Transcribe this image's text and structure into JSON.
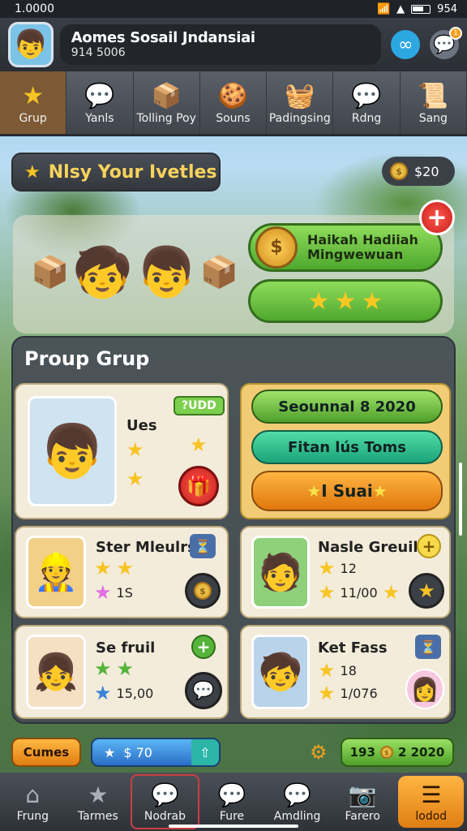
{
  "status_bar": {
    "time": "1.0000",
    "battery": "954"
  },
  "header": {
    "name": "Aomes Sosail Jndansiai",
    "id": "914 5006"
  },
  "tabs": [
    {
      "label": "Grup",
      "icon": "★"
    },
    {
      "label": "Yanls",
      "icon": "💬"
    },
    {
      "label": "Tolling Poy",
      "icon": "📦"
    },
    {
      "label": "Souns",
      "icon": "🍪"
    },
    {
      "label": "Padingsing",
      "icon": "🧺"
    },
    {
      "label": "Rdng",
      "icon": "💬"
    },
    {
      "label": "Sang",
      "icon": "📜"
    }
  ],
  "title_pill": {
    "text": "Nlsy Your Ivetles"
  },
  "coins": {
    "amount": "$20"
  },
  "banner": {
    "reward_label": "Haikah Hadiiah Mingwewuan"
  },
  "group": {
    "title": "Proup Grup"
  },
  "main_card": {
    "name": "Ues",
    "badge": "?UDD"
  },
  "right_buttons": [
    "Seounnal 8 2020",
    "Fitan lús Toms",
    "I Suai"
  ],
  "members": [
    {
      "name": "Ster Mleulrs",
      "value": "1S"
    },
    {
      "name": "Nasle Greuile",
      "value1": "12",
      "value2": "11/00"
    },
    {
      "name": "Se fruil",
      "value": "15,00"
    },
    {
      "name": "Ket Fass",
      "value1": "18",
      "value2": "1/076"
    }
  ],
  "bottom_strip": {
    "orange_label": "Cumes",
    "blue_value": "$ 70",
    "green_value1": "193",
    "green_value2": "2 2020"
  },
  "bottom_nav": [
    {
      "label": "Frung",
      "icon": "⌂"
    },
    {
      "label": "Tarmes",
      "icon": "★"
    },
    {
      "label": "Nodrab",
      "icon": "💬"
    },
    {
      "label": "Fure",
      "icon": "💬"
    },
    {
      "label": "Amdling",
      "icon": "💬"
    },
    {
      "label": "Farero",
      "icon": "📷"
    },
    {
      "label": "lodod",
      "icon": "☰"
    }
  ]
}
